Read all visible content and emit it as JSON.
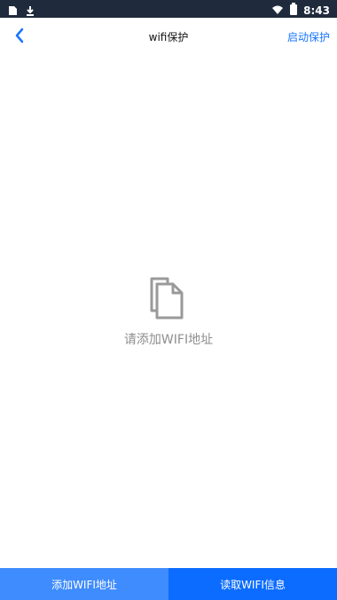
{
  "status_bar": {
    "time": "8:43",
    "icons": [
      "sd-card-icon",
      "download-icon",
      "wifi-icon",
      "battery-icon"
    ]
  },
  "toolbar": {
    "title": "wifi保护",
    "action_label": "启动保护"
  },
  "empty_state": {
    "icon": "document-copy-icon",
    "message": "请添加WIFI地址"
  },
  "bottom_bar": {
    "add_label": "添加WIFI地址",
    "read_label": "读取WIFI信息",
    "add_color": "#3f8cff",
    "read_color": "#0b6cff"
  },
  "colors": {
    "accent": "#1976ff",
    "status_bar_bg": "#1f2a3d"
  }
}
